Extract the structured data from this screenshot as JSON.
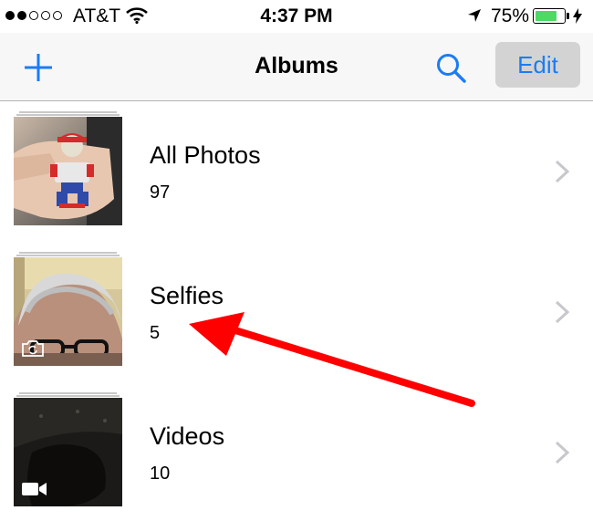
{
  "status_bar": {
    "signal_bars_filled": 2,
    "signal_bars_total": 5,
    "carrier": "AT&T",
    "time": "4:37 PM",
    "battery_percent": "75%",
    "battery_level": 0.75,
    "battery_color": "#4cd964"
  },
  "nav": {
    "title": "Albums",
    "edit_label": "Edit",
    "accent_color": "#1a7cf6"
  },
  "albums": [
    {
      "name": "All Photos",
      "count": "97",
      "thumbnail": "toy-figure-in-hand"
    },
    {
      "name": "Selfies",
      "count": "5",
      "thumbnail": "selfie-face",
      "badge_icon": "front-camera-icon"
    },
    {
      "name": "Videos",
      "count": "10",
      "thumbnail": "dark-video-frame",
      "badge_icon": "video-camera-icon"
    }
  ],
  "annotation": {
    "color": "#ff0000",
    "points_to": "Selfies count"
  }
}
